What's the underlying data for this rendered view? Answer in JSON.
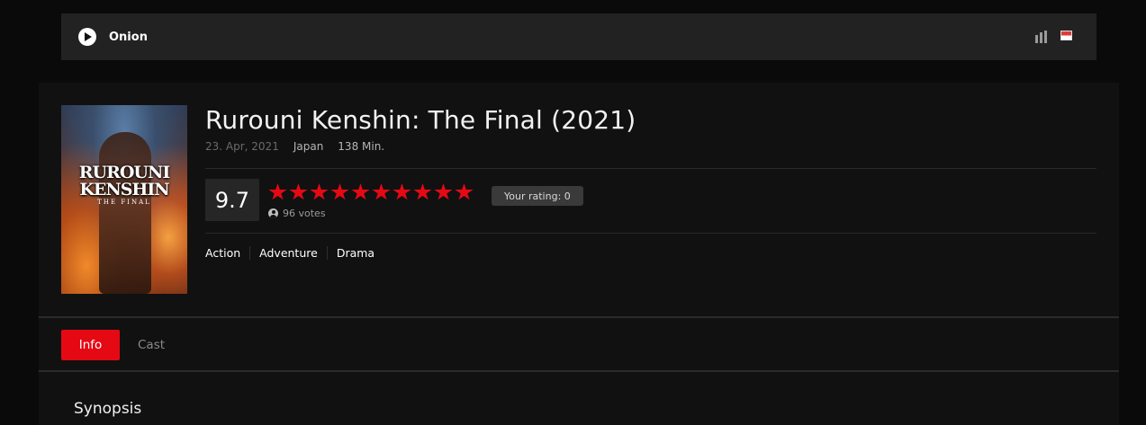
{
  "header": {
    "site_name": "Onion",
    "icons": [
      "play-circle-icon",
      "signal-bars-icon",
      "flag-icon"
    ]
  },
  "movie": {
    "title": "Rurouni Kenshin: The Final (2021)",
    "release_date": "23. Apr, 2021",
    "country": "Japan",
    "runtime": "138 Min.",
    "poster": {
      "title_line1": "RUROUNI",
      "title_line2": "KENSHIN",
      "subtitle": "THE FINAL"
    },
    "score": "9.7",
    "stars_filled": 10,
    "stars_total": 10,
    "votes": "96 votes",
    "your_rating": "Your rating: 0",
    "genres": [
      "Action",
      "Adventure",
      "Drama"
    ]
  },
  "tabs": [
    {
      "label": "Info",
      "active": true
    },
    {
      "label": "Cast",
      "active": false
    }
  ],
  "section": {
    "synopsis_heading": "Synopsis"
  },
  "colors": {
    "accent": "#e50914",
    "background": "#0a0a0a",
    "panel": "#111111",
    "topbar": "#222222"
  }
}
